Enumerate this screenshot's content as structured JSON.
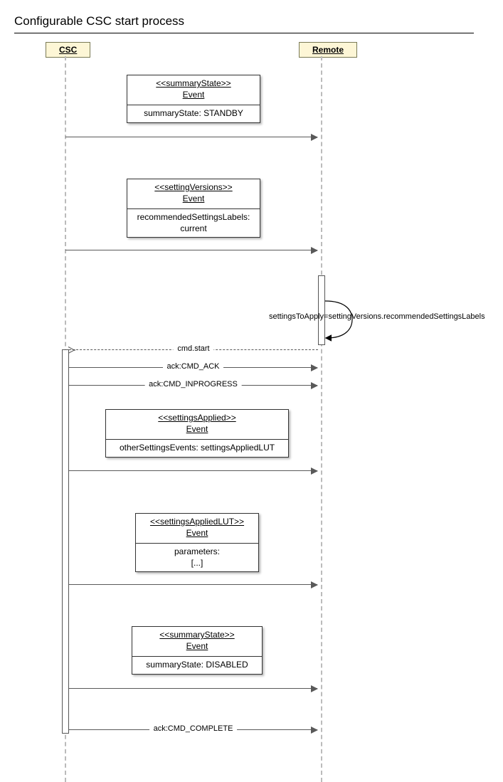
{
  "title": "Configurable CSC start process",
  "participants": {
    "csc": "CSC",
    "remote": "Remote"
  },
  "events": {
    "summaryStandby": {
      "stereo": "<<summaryState>>",
      "name": "Event",
      "body": "summaryState: STANDBY"
    },
    "settingVersions": {
      "stereo": "<<settingVersions>>",
      "name": "Event",
      "body1": "recommendedSettingsLabels:",
      "body2": "current"
    },
    "settingsApplied": {
      "stereo": "<<settingsApplied>>",
      "name": "Event",
      "body": "otherSettingsEvents: settingsAppliedLUT"
    },
    "settingsLUT": {
      "stereo": "<<settingsAppliedLUT>>",
      "name": "Event",
      "body1": "parameters:",
      "body2": "[...]"
    },
    "summaryDisabled": {
      "stereo": "<<summaryState>>",
      "name": "Event",
      "body": "summaryState: DISABLED"
    }
  },
  "selfmsg": "settingsToApply=settingVersions.recommendedSettingsLabels",
  "arrows": {
    "cmdStart": "cmd.start",
    "ackCmdAck": "ack:CMD_ACK",
    "ackInProg": "ack:CMD_INPROGRESS",
    "ackComplete": "ack:CMD_COMPLETE"
  }
}
